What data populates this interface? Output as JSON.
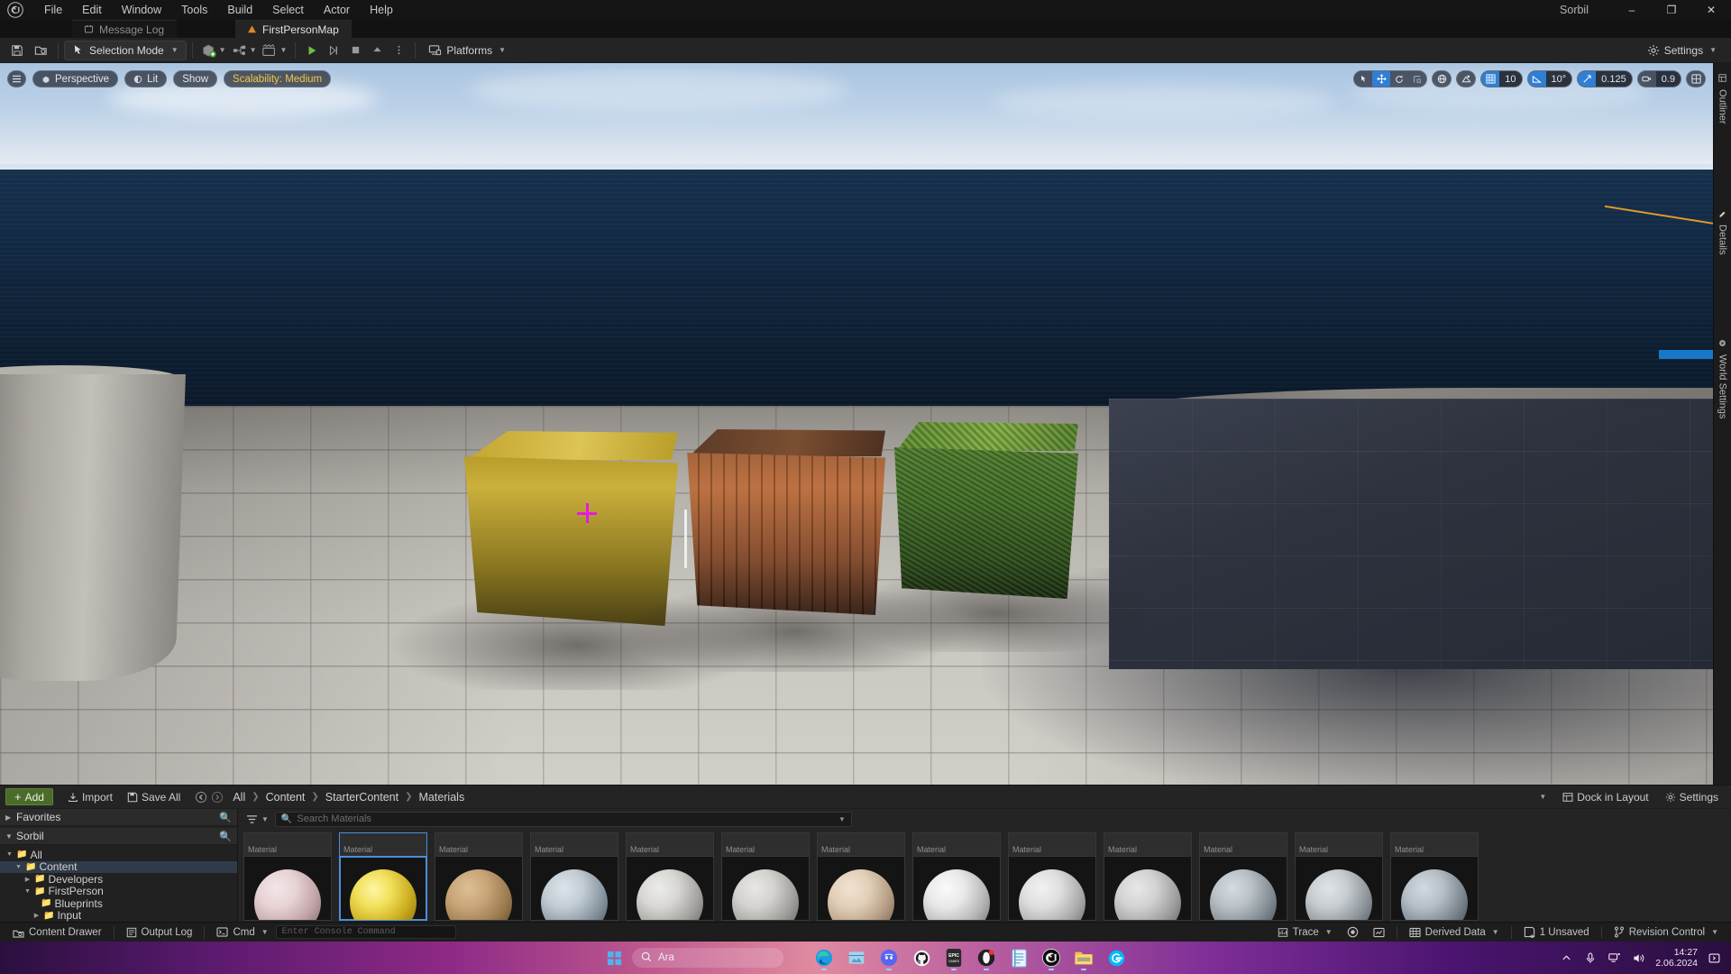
{
  "titlebar": {
    "menus": [
      "File",
      "Edit",
      "Window",
      "Tools",
      "Build",
      "Select",
      "Actor",
      "Help"
    ],
    "project_name": "Sorbil",
    "minimize": "–",
    "maximize": "❐",
    "close": "✕"
  },
  "tabs": [
    {
      "label": "Message Log",
      "icon": "message-log-icon",
      "active": false
    },
    {
      "label": "FirstPersonMap",
      "icon": "level-icon",
      "active": true
    }
  ],
  "toolbar": {
    "save_icon": "save-icon",
    "browse_icon": "browse-icon",
    "mode_label": "Selection Mode",
    "add_icon": "add-actor-icon",
    "blueprint_icon": "blueprints-icon",
    "cinematics_icon": "cinematics-icon",
    "play_icon": "play-icon",
    "skipplay_icon": "step-icon",
    "stop_icon": "stop-icon",
    "eject_icon": "eject-icon",
    "more_icon": "more-options-icon",
    "platforms_label": "Platforms",
    "settings_label": "Settings"
  },
  "viewport": {
    "menu_icon": "viewport-menu-icon",
    "perspective_label": "Perspective",
    "lit_label": "Lit",
    "show_label": "Show",
    "scalability_label": "Scalability: Medium",
    "scalability_color": "#f5c542",
    "accent_blue": "#2f7fd4",
    "transform_tools": [
      "select-icon",
      "move-icon",
      "rotate-icon",
      "scale-icon"
    ],
    "coord_icon": "world-coordinate-icon",
    "surface_snap_icon": "surface-snap-icon",
    "grid_snap_icon": "grid-snap-icon",
    "grid_snap_value": "10",
    "angle_snap_icon": "angle-snap-icon",
    "angle_snap_value": "10°",
    "scale_snap_icon": "scale-snap-icon",
    "scale_snap_value": "0.125",
    "camera_speed_icon": "camera-speed-icon",
    "camera_speed_value": "0.9",
    "maximize_icon": "viewport-layout-icon"
  },
  "side_tabs": [
    {
      "label": "Outliner",
      "icon": "outliner-icon"
    },
    {
      "label": "Details",
      "icon": "details-icon"
    },
    {
      "label": "World Settings",
      "icon": "world-settings-icon"
    }
  ],
  "content_browser": {
    "add_label": "Add",
    "import_label": "Import",
    "save_all_label": "Save All",
    "back_icon": "nav-back-icon",
    "forward_icon": "nav-forward-icon",
    "breadcrumbs": [
      "All",
      "Content",
      "StarterContent",
      "Materials"
    ],
    "dock_label": "Dock in Layout",
    "settings_label": "Settings",
    "collapse_icon": "chevron-down-icon",
    "favorites_label": "Favorites",
    "sources_label": "Sorbil",
    "filter_label": "filter-icon",
    "search_placeholder": "Search Materials",
    "search_value": "",
    "tree": [
      {
        "label": "All",
        "depth": 0,
        "expanded": true,
        "selected": false
      },
      {
        "label": "Content",
        "depth": 1,
        "expanded": true,
        "selected": true
      },
      {
        "label": "Developers",
        "depth": 2,
        "expanded": false,
        "selected": false
      },
      {
        "label": "FirstPerson",
        "depth": 2,
        "expanded": true,
        "selected": false
      },
      {
        "label": "Blueprints",
        "depth": 3,
        "expanded": null,
        "selected": false
      },
      {
        "label": "Input",
        "depth": 3,
        "expanded": false,
        "selected": false
      }
    ],
    "assets": [
      {
        "type": "Material",
        "selected": false,
        "color_a": "#e7d2d4",
        "color_b": "#a98b8f"
      },
      {
        "type": "Material",
        "selected": true,
        "color_a": "#f1e05a",
        "color_b": "#9a8412"
      },
      {
        "type": "Material",
        "selected": false,
        "color_a": "#c9a578",
        "color_b": "#6e5333"
      },
      {
        "type": "Material",
        "selected": false,
        "color_a": "#c2ccd4",
        "color_b": "#5d6a77"
      },
      {
        "type": "Material",
        "selected": false,
        "color_a": "#d8d6d2",
        "color_b": "#7f7d79"
      },
      {
        "type": "Material",
        "selected": false,
        "color_a": "#d4d2ce",
        "color_b": "#82807c"
      },
      {
        "type": "Material",
        "selected": false,
        "color_a": "#e2cfb9",
        "color_b": "#95806a"
      },
      {
        "type": "Material",
        "selected": false,
        "color_a": "#e8e8e8",
        "color_b": "#989898"
      },
      {
        "type": "Material",
        "selected": false,
        "color_a": "#dedede",
        "color_b": "#8e8e8e"
      },
      {
        "type": "Material",
        "selected": false,
        "color_a": "#d2d2d2",
        "color_b": "#868686"
      },
      {
        "type": "Material",
        "selected": false,
        "color_a": "#b9c1c6",
        "color_b": "#5a646c"
      },
      {
        "type": "Material",
        "selected": false,
        "color_a": "#c6ccd0",
        "color_b": "#6b7378"
      },
      {
        "type": "Material",
        "selected": false,
        "color_a": "#b6bfc6",
        "color_b": "#57616a"
      }
    ]
  },
  "status_bar": {
    "content_drawer_label": "Content Drawer",
    "output_log_label": "Output Log",
    "cmd_label": "Cmd",
    "console_placeholder": "Enter Console Command",
    "console_value": "",
    "trace_label": "Trace",
    "record_icon": "record-icon",
    "insights_icon": "insights-icon",
    "derived_data_label": "Derived Data",
    "unsaved_label": "1 Unsaved",
    "revision_label": "Revision Control"
  },
  "taskbar": {
    "start_label": "start-button",
    "search_placeholder": "Ara",
    "apps": [
      {
        "name": "edge-icon",
        "running": true
      },
      {
        "name": "microsoft-store-icon",
        "running": false
      },
      {
        "name": "discord-icon",
        "running": true
      },
      {
        "name": "github-icon",
        "running": false
      },
      {
        "name": "epic-games-icon",
        "running": true
      },
      {
        "name": "opera-gx-icon",
        "running": true
      },
      {
        "name": "notepad-icon",
        "running": false
      },
      {
        "name": "unreal-engine-icon",
        "running": true
      },
      {
        "name": "file-explorer-icon",
        "running": true
      },
      {
        "name": "logitech-icon",
        "running": false
      }
    ],
    "tray_icons": [
      "chevron-up-icon",
      "microphone-icon",
      "network-icon",
      "volume-icon"
    ],
    "time": "14:27",
    "date": "2.06.2024",
    "notification_icon": "notification-icon"
  }
}
